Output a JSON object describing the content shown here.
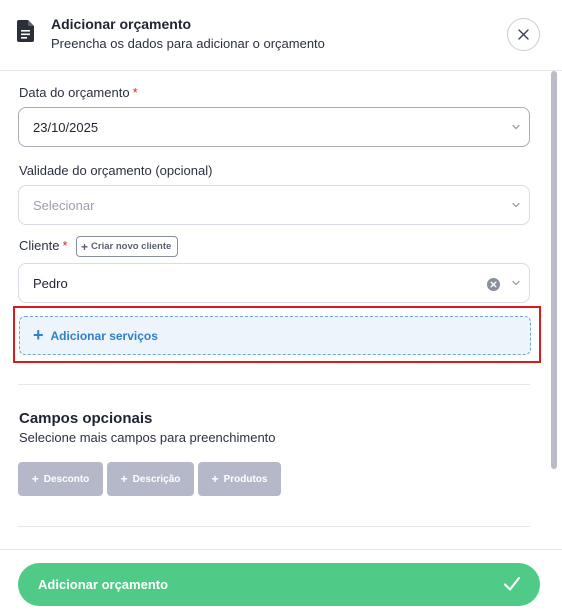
{
  "header": {
    "title": "Adicionar orçamento",
    "subtitle": "Preencha os dados para adicionar o orçamento"
  },
  "form": {
    "date": {
      "label": "Data do orçamento",
      "required_mark": "*",
      "value": "23/10/2025"
    },
    "validity": {
      "label": "Validade do orçamento (opcional)",
      "placeholder": "Selecionar"
    },
    "client": {
      "label": "Cliente",
      "required_mark": "*",
      "new_client_label": "Criar novo cliente",
      "value": "Pedro"
    },
    "add_services_label": "Adicionar serviços"
  },
  "optional_fields": {
    "title": "Campos opcionais",
    "subtitle": "Selecione mais campos para preenchimento",
    "chips": [
      {
        "label": "Desconto"
      },
      {
        "label": "Descrição"
      },
      {
        "label": "Produtos"
      }
    ]
  },
  "footer": {
    "submit_label": "Adicionar orçamento"
  },
  "icons": {
    "header": "document-icon",
    "close": "close-icon",
    "chevron": "chevron-down-icon",
    "clear": "clear-icon",
    "plus": "plus-icon",
    "check": "check-icon"
  },
  "colors": {
    "accent_green": "#4fcb87",
    "link_blue": "#2f7fca",
    "required_red": "#e02424",
    "highlight_red": "#d61c1c",
    "chip_gray": "#b4b8c8"
  }
}
